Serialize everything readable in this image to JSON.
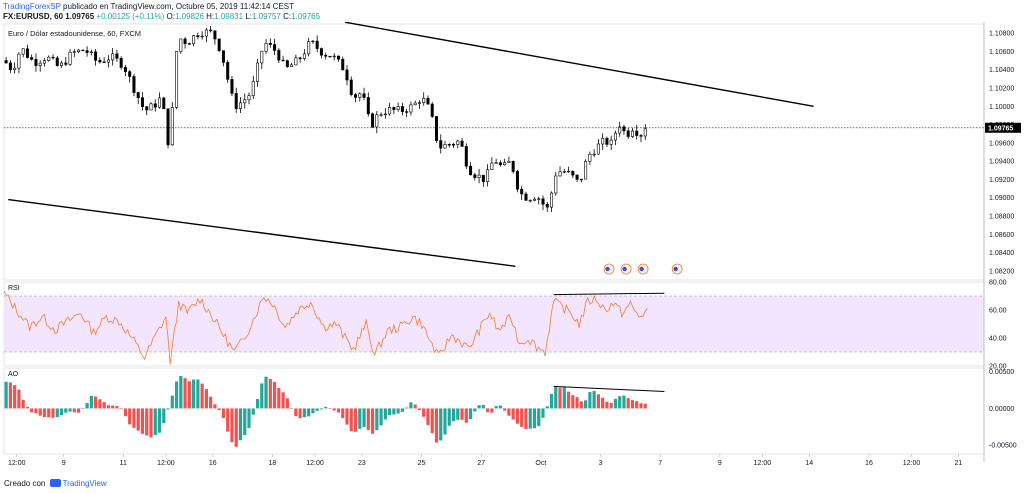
{
  "header": {
    "author": "TradingForexSP",
    "published_text": "publicado en TradingView.com, Octubre 05, 2019 11:42:14 CEST",
    "symbol_line": "FX:EURUSD, 60",
    "close_value": "1.09765",
    "change": "+0.00125 (+0.11%)",
    "o_label": "O:",
    "o_value": "1.09826",
    "h_label": "H:",
    "h_value": "1.09831",
    "l_label": "L:",
    "l_value": "1.09757",
    "c_label": "C:",
    "c_value": "1.09765"
  },
  "footer": {
    "created_with": "Creado con",
    "tradingview": "TradingView"
  },
  "colors": {
    "candle": "#000000",
    "rsi_line": "#f57c2c",
    "rsi_band": "#f3e5fd",
    "ao_up": "#26a69a",
    "ao_down": "#ef5350",
    "price_tag_bg": "#000000"
  },
  "chart_data": [
    {
      "type": "candlestick",
      "title": "Euro / Dólar estadounidense, 60, FXCM",
      "ylim": [
        1.081,
        1.109
      ],
      "yticks": [
        "1.10800",
        "1.10600",
        "1.10400",
        "1.10200",
        "1.10000",
        "1.09800",
        "1.09600",
        "1.09400",
        "1.09200",
        "1.09000",
        "1.08800",
        "1.08600",
        "1.08400",
        "1.08200"
      ],
      "ytick_values": [
        1.108,
        1.106,
        1.104,
        1.102,
        1.1,
        1.098,
        1.096,
        1.094,
        1.092,
        1.09,
        1.088,
        1.086,
        1.084,
        1.082
      ],
      "current_price": "1.09765",
      "current_price_value": 1.09765,
      "xlim": [
        0,
        230
      ],
      "x_ticks": [
        {
          "label": "12:00",
          "x": 3
        },
        {
          "label": "9",
          "x": 14
        },
        {
          "label": "11",
          "x": 28
        },
        {
          "label": "12:00",
          "x": 38
        },
        {
          "label": "16",
          "x": 49
        },
        {
          "label": "18",
          "x": 63
        },
        {
          "label": "12:00",
          "x": 73
        },
        {
          "label": "23",
          "x": 84
        },
        {
          "label": "25",
          "x": 98
        },
        {
          "label": "27",
          "x": 112
        },
        {
          "label": "Oct",
          "x": 126
        },
        {
          "label": "3",
          "x": 140
        },
        {
          "label": "7",
          "x": 154
        },
        {
          "label": "9",
          "x": 168
        },
        {
          "label": "12:00",
          "x": 178
        },
        {
          "label": "14",
          "x": 189
        },
        {
          "label": "16",
          "x": 203
        },
        {
          "label": "12:00",
          "x": 213
        },
        {
          "label": "21",
          "x": 224
        }
      ],
      "anchor_points": [
        {
          "x": 0,
          "y": 1.105
        },
        {
          "x": 2,
          "y": 1.104
        },
        {
          "x": 4,
          "y": 1.1064
        },
        {
          "x": 7,
          "y": 1.1048
        },
        {
          "x": 10,
          "y": 1.1054
        },
        {
          "x": 13,
          "y": 1.1042
        },
        {
          "x": 16,
          "y": 1.1058
        },
        {
          "x": 19,
          "y": 1.1062
        },
        {
          "x": 22,
          "y": 1.1048
        },
        {
          "x": 25,
          "y": 1.1054
        },
        {
          "x": 28,
          "y": 1.1046
        },
        {
          "x": 30,
          "y": 1.1025
        },
        {
          "x": 33,
          "y": 1.0995
        },
        {
          "x": 35,
          "y": 1.1
        },
        {
          "x": 37,
          "y": 1.101
        },
        {
          "x": 39,
          "y": 1.0946
        },
        {
          "x": 40,
          "y": 1.1045
        },
        {
          "x": 41,
          "y": 1.1075
        },
        {
          "x": 43,
          "y": 1.107
        },
        {
          "x": 46,
          "y": 1.1082
        },
        {
          "x": 49,
          "y": 1.108
        },
        {
          "x": 51,
          "y": 1.106
        },
        {
          "x": 54,
          "y": 1.1
        },
        {
          "x": 56,
          "y": 1.1005
        },
        {
          "x": 58,
          "y": 1.1015
        },
        {
          "x": 61,
          "y": 1.107
        },
        {
          "x": 64,
          "y": 1.106
        },
        {
          "x": 66,
          "y": 1.104
        },
        {
          "x": 69,
          "y": 1.105
        },
        {
          "x": 72,
          "y": 1.107
        },
        {
          "x": 75,
          "y": 1.1058
        },
        {
          "x": 77,
          "y": 1.1055
        },
        {
          "x": 80,
          "y": 1.104
        },
        {
          "x": 82,
          "y": 1.101
        },
        {
          "x": 84,
          "y": 1.1015
        },
        {
          "x": 86,
          "y": 1.0978
        },
        {
          "x": 88,
          "y": 1.0992
        },
        {
          "x": 90,
          "y": 1.0996
        },
        {
          "x": 93,
          "y": 1.0995
        },
        {
          "x": 96,
          "y": 1.1
        },
        {
          "x": 98,
          "y": 1.101
        },
        {
          "x": 100,
          "y": 1.0995
        },
        {
          "x": 102,
          "y": 1.0955
        },
        {
          "x": 104,
          "y": 1.0958
        },
        {
          "x": 107,
          "y": 1.0962
        },
        {
          "x": 109,
          "y": 1.0932
        },
        {
          "x": 111,
          "y": 1.0924
        },
        {
          "x": 113,
          "y": 1.092
        },
        {
          "x": 115,
          "y": 1.0943
        },
        {
          "x": 117,
          "y": 1.0932
        },
        {
          "x": 119,
          "y": 1.094
        },
        {
          "x": 121,
          "y": 1.0905
        },
        {
          "x": 123,
          "y": 1.09
        },
        {
          "x": 125,
          "y": 1.0903
        },
        {
          "x": 127,
          "y": 1.089
        },
        {
          "x": 128,
          "y": 1.0886
        },
        {
          "x": 129,
          "y": 1.0925
        },
        {
          "x": 131,
          "y": 1.093
        },
        {
          "x": 133,
          "y": 1.0925
        },
        {
          "x": 135,
          "y": 1.0915
        },
        {
          "x": 137,
          "y": 1.0945
        },
        {
          "x": 139,
          "y": 1.0955
        },
        {
          "x": 141,
          "y": 1.0962
        },
        {
          "x": 143,
          "y": 1.0958
        },
        {
          "x": 144,
          "y": 1.0985
        },
        {
          "x": 146,
          "y": 1.0968
        },
        {
          "x": 148,
          "y": 1.098
        },
        {
          "x": 149,
          "y": 1.0966
        },
        {
          "x": 151,
          "y": 1.0982
        }
      ],
      "trendlines_price": [
        {
          "x1": 80,
          "y1": 1.1092,
          "x2": 190,
          "y2": 1.1
        },
        {
          "x1": 1,
          "y1": 1.0898,
          "x2": 120,
          "y2": 1.0825
        }
      ]
    },
    {
      "type": "line",
      "title": "RSI",
      "ylim": [
        20,
        80
      ],
      "yticks": [
        "80.00",
        "60.00",
        "40.00",
        "20.00"
      ],
      "ytick_values": [
        80,
        60,
        40,
        20
      ],
      "band": [
        30,
        70
      ],
      "anchor_points": [
        {
          "x": 0,
          "y": 72
        },
        {
          "x": 3,
          "y": 60
        },
        {
          "x": 6,
          "y": 48
        },
        {
          "x": 9,
          "y": 55
        },
        {
          "x": 12,
          "y": 46
        },
        {
          "x": 15,
          "y": 52
        },
        {
          "x": 18,
          "y": 58
        },
        {
          "x": 21,
          "y": 44
        },
        {
          "x": 24,
          "y": 55
        },
        {
          "x": 27,
          "y": 52
        },
        {
          "x": 30,
          "y": 40
        },
        {
          "x": 33,
          "y": 26
        },
        {
          "x": 36,
          "y": 44
        },
        {
          "x": 38,
          "y": 55
        },
        {
          "x": 39,
          "y": 22
        },
        {
          "x": 41,
          "y": 65
        },
        {
          "x": 43,
          "y": 58
        },
        {
          "x": 46,
          "y": 68
        },
        {
          "x": 49,
          "y": 55
        },
        {
          "x": 52,
          "y": 40
        },
        {
          "x": 54,
          "y": 30
        },
        {
          "x": 56,
          "y": 38
        },
        {
          "x": 58,
          "y": 50
        },
        {
          "x": 61,
          "y": 70
        },
        {
          "x": 63,
          "y": 65
        },
        {
          "x": 66,
          "y": 48
        },
        {
          "x": 69,
          "y": 60
        },
        {
          "x": 72,
          "y": 66
        },
        {
          "x": 75,
          "y": 48
        },
        {
          "x": 78,
          "y": 50
        },
        {
          "x": 80,
          "y": 40
        },
        {
          "x": 82,
          "y": 32
        },
        {
          "x": 85,
          "y": 50
        },
        {
          "x": 87,
          "y": 28
        },
        {
          "x": 90,
          "y": 45
        },
        {
          "x": 93,
          "y": 48
        },
        {
          "x": 96,
          "y": 55
        },
        {
          "x": 98,
          "y": 50
        },
        {
          "x": 100,
          "y": 38
        },
        {
          "x": 102,
          "y": 26
        },
        {
          "x": 105,
          "y": 42
        },
        {
          "x": 107,
          "y": 38
        },
        {
          "x": 109,
          "y": 32
        },
        {
          "x": 112,
          "y": 48
        },
        {
          "x": 114,
          "y": 58
        },
        {
          "x": 116,
          "y": 45
        },
        {
          "x": 119,
          "y": 55
        },
        {
          "x": 121,
          "y": 36
        },
        {
          "x": 123,
          "y": 40
        },
        {
          "x": 125,
          "y": 34
        },
        {
          "x": 127,
          "y": 30
        },
        {
          "x": 129,
          "y": 66
        },
        {
          "x": 131,
          "y": 62
        },
        {
          "x": 133,
          "y": 58
        },
        {
          "x": 135,
          "y": 50
        },
        {
          "x": 137,
          "y": 66
        },
        {
          "x": 139,
          "y": 68
        },
        {
          "x": 141,
          "y": 60
        },
        {
          "x": 143,
          "y": 65
        },
        {
          "x": 145,
          "y": 58
        },
        {
          "x": 147,
          "y": 64
        },
        {
          "x": 149,
          "y": 55
        },
        {
          "x": 151,
          "y": 60
        }
      ],
      "trendline": {
        "x1": 129,
        "y1": 71,
        "x2": 155,
        "y2": 72
      }
    },
    {
      "type": "bar",
      "title": "AO",
      "ylim": [
        -0.0062,
        0.0055
      ],
      "yticks": [
        "0.00500",
        "0.00000",
        "-0.00500"
      ],
      "ytick_values": [
        0.005,
        0.0,
        -0.005
      ],
      "anchor_points": [
        {
          "x": 0,
          "y": 0.0038
        },
        {
          "x": 3,
          "y": 0.003
        },
        {
          "x": 6,
          "y": -0.0005
        },
        {
          "x": 9,
          "y": -0.001
        },
        {
          "x": 12,
          "y": -0.0012
        },
        {
          "x": 15,
          "y": -0.0006
        },
        {
          "x": 18,
          "y": -0.0004
        },
        {
          "x": 21,
          "y": 0.002
        },
        {
          "x": 24,
          "y": 0.0005
        },
        {
          "x": 27,
          "y": 0.0003
        },
        {
          "x": 30,
          "y": -0.0025
        },
        {
          "x": 33,
          "y": -0.0035
        },
        {
          "x": 35,
          "y": -0.004
        },
        {
          "x": 37,
          "y": -0.003
        },
        {
          "x": 39,
          "y": 0.001
        },
        {
          "x": 41,
          "y": 0.0045
        },
        {
          "x": 43,
          "y": 0.0038
        },
        {
          "x": 46,
          "y": 0.004
        },
        {
          "x": 49,
          "y": 0.001
        },
        {
          "x": 51,
          "y": -0.0005
        },
        {
          "x": 54,
          "y": -0.0055
        },
        {
          "x": 56,
          "y": -0.004
        },
        {
          "x": 58,
          "y": -0.002
        },
        {
          "x": 61,
          "y": 0.0045
        },
        {
          "x": 63,
          "y": 0.0038
        },
        {
          "x": 66,
          "y": 0.0018
        },
        {
          "x": 69,
          "y": -0.0015
        },
        {
          "x": 72,
          "y": -0.001
        },
        {
          "x": 75,
          "y": 0.0002
        },
        {
          "x": 78,
          "y": -0.0003
        },
        {
          "x": 80,
          "y": -0.0018
        },
        {
          "x": 82,
          "y": -0.0035
        },
        {
          "x": 84,
          "y": -0.0025
        },
        {
          "x": 87,
          "y": -0.0035
        },
        {
          "x": 90,
          "y": -0.001
        },
        {
          "x": 93,
          "y": -0.0008
        },
        {
          "x": 96,
          "y": 0.001
        },
        {
          "x": 98,
          "y": -0.0005
        },
        {
          "x": 100,
          "y": -0.003
        },
        {
          "x": 102,
          "y": -0.005
        },
        {
          "x": 105,
          "y": -0.002
        },
        {
          "x": 107,
          "y": -0.0015
        },
        {
          "x": 109,
          "y": -0.002
        },
        {
          "x": 112,
          "y": 0.001
        },
        {
          "x": 114,
          "y": -0.001
        },
        {
          "x": 116,
          "y": 0.0008
        },
        {
          "x": 119,
          "y": -0.0012
        },
        {
          "x": 121,
          "y": -0.0025
        },
        {
          "x": 123,
          "y": -0.003
        },
        {
          "x": 126,
          "y": -0.0022
        },
        {
          "x": 129,
          "y": 0.0028
        },
        {
          "x": 131,
          "y": 0.003
        },
        {
          "x": 133,
          "y": 0.002
        },
        {
          "x": 136,
          "y": 0.0008
        },
        {
          "x": 138,
          "y": 0.0025
        },
        {
          "x": 140,
          "y": 0.0018
        },
        {
          "x": 142,
          "y": 0.0005
        },
        {
          "x": 145,
          "y": 0.002
        },
        {
          "x": 148,
          "y": 0.001
        },
        {
          "x": 151,
          "y": 0.0005
        }
      ],
      "trendline": {
        "x1": 129,
        "y1": 0.003,
        "x2": 155,
        "y2": 0.0023
      }
    }
  ]
}
